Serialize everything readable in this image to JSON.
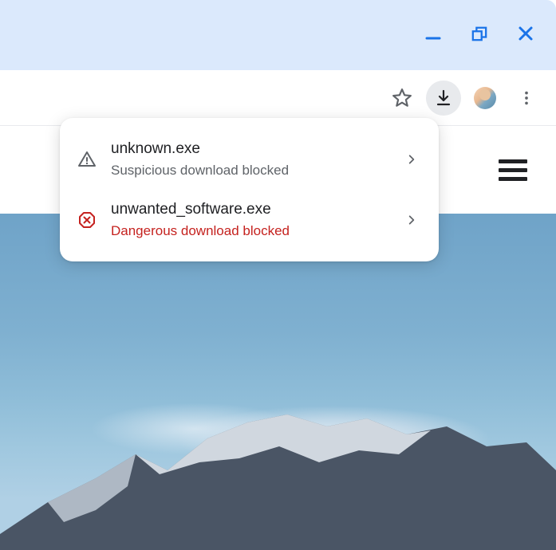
{
  "downloads": {
    "items": [
      {
        "filename": "unknown.exe",
        "status": "Suspicious download blocked",
        "severity": "suspicious",
        "icon": "warning-triangle",
        "status_color": "#5f6368"
      },
      {
        "filename": "unwanted_software.exe",
        "status": "Dangerous download blocked",
        "severity": "dangerous",
        "icon": "danger-octagon",
        "status_color": "#c5221f"
      }
    ]
  },
  "colors": {
    "title_bar_bg": "#dbe9fc",
    "accent_blue": "#1a73e8",
    "danger_red": "#c5221f",
    "text_primary": "#202124",
    "text_secondary": "#5f6368"
  }
}
